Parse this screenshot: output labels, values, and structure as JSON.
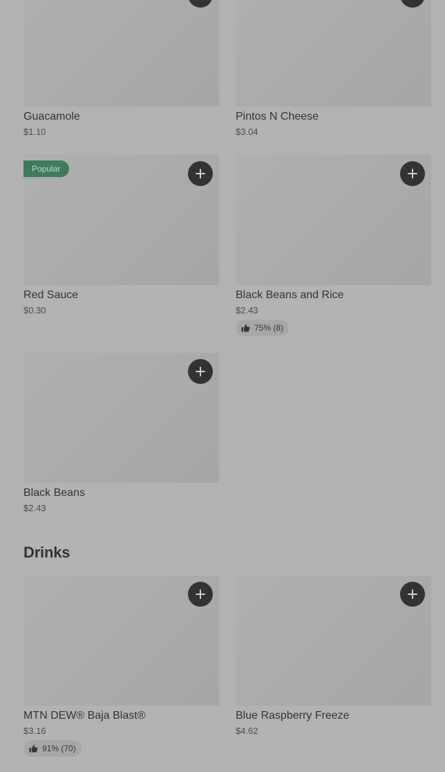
{
  "icons": {
    "add": "plus-icon",
    "rating": "thumbs-up-icon"
  },
  "colors": {
    "popular_badge": "#3f7a5c",
    "add_button": "#333333"
  },
  "items": [
    {
      "name": "Guacamole",
      "price": "$1.10"
    },
    {
      "name": "Pintos N Cheese",
      "price": "$3.04"
    },
    {
      "badge": "Popular",
      "name": "Red Sauce",
      "price": "$0.30"
    },
    {
      "name": "Black Beans and Rice",
      "price": "$2.43",
      "rating": "75% (8)"
    },
    {
      "name": "Black Beans",
      "price": "$2.43"
    }
  ],
  "drinks": {
    "title": "Drinks",
    "items": [
      {
        "name": "MTN DEW® Baja Blast®",
        "price": "$3.16",
        "rating": "91% (70)"
      },
      {
        "name": "Blue Raspberry Freeze",
        "price": "$4.62"
      }
    ]
  }
}
